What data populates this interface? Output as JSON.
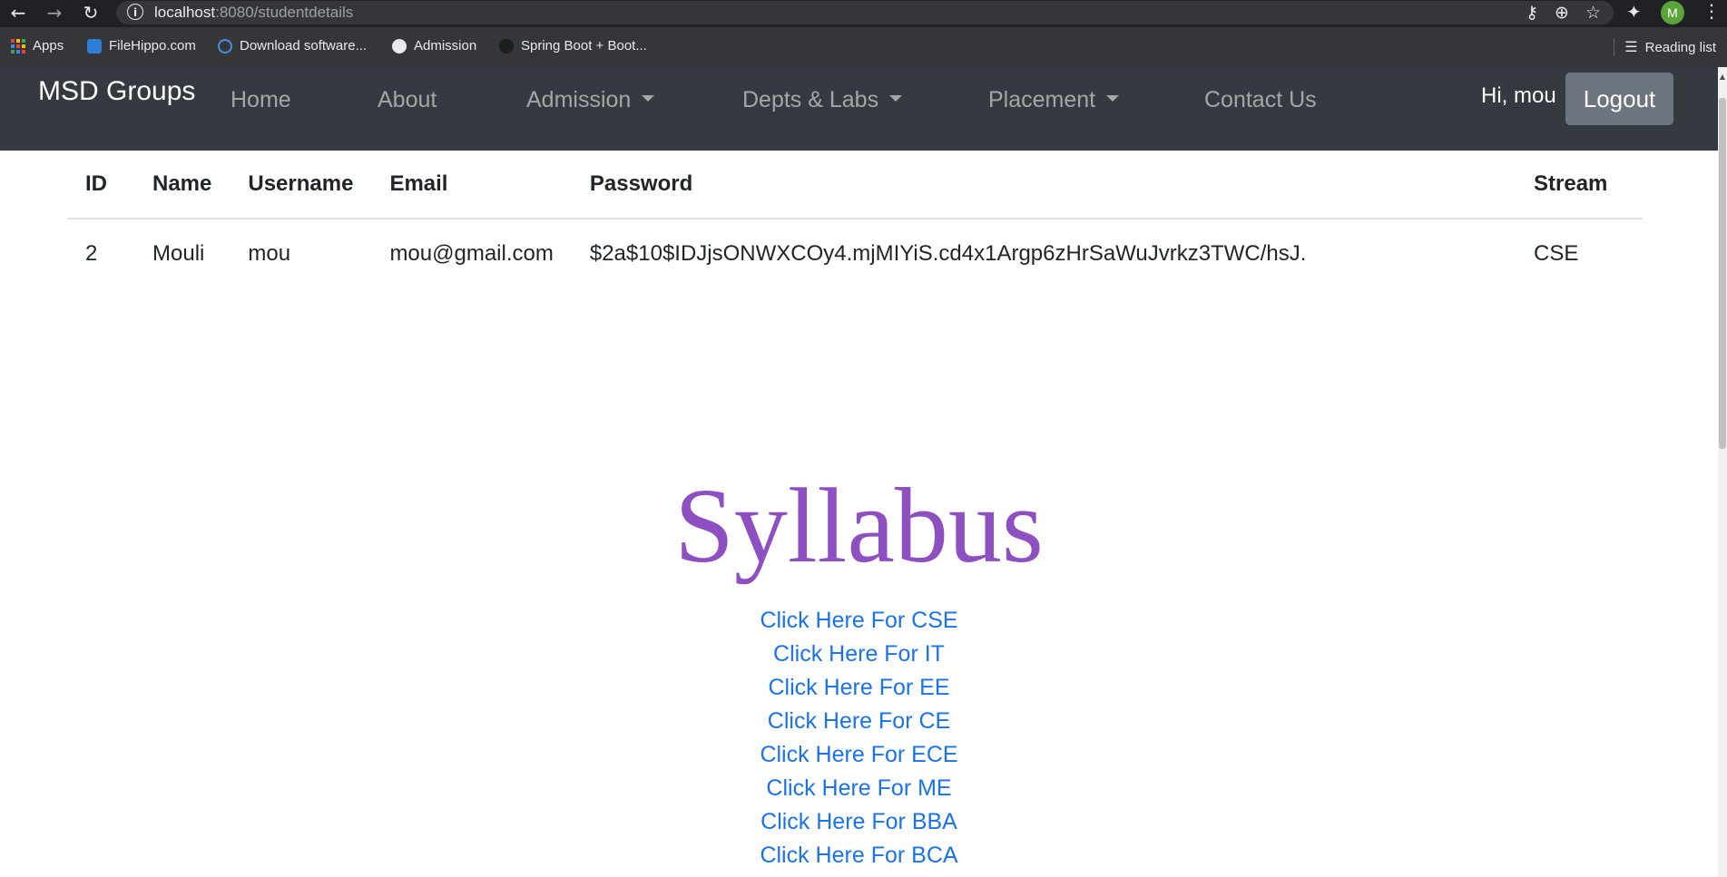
{
  "browser": {
    "url_host": "localhost",
    "url_rest": ":8080/studentdetails",
    "avatar_letter": "M",
    "bookmarks": [
      {
        "label": "Apps"
      },
      {
        "label": "FileHippo.com"
      },
      {
        "label": "Download software..."
      },
      {
        "label": "Admission"
      },
      {
        "label": "Spring Boot + Boot..."
      }
    ],
    "reading_list": "Reading list"
  },
  "navbar": {
    "brand": "MSD Groups",
    "links": [
      {
        "label": "Home"
      },
      {
        "label": "About"
      },
      {
        "label": "Admission"
      },
      {
        "label": "Depts & Labs"
      },
      {
        "label": "Placement"
      },
      {
        "label": "Contact Us"
      }
    ],
    "greeting": "Hi, mou",
    "logout_label": "Logout"
  },
  "table": {
    "headers": [
      "ID",
      "Name",
      "Username",
      "Email",
      "Password",
      "Stream"
    ],
    "rows": [
      [
        "2",
        "Mouli",
        "mou",
        "mou@gmail.com",
        "$2a$10$IDJjsONWXCOy4.mjMIYiS.cd4x1Argp6zHrSaWuJvrkz3TWC/hsJ.",
        "CSE"
      ]
    ]
  },
  "syllabus": {
    "title": "Syllabus",
    "links": [
      "Click Here For CSE",
      "Click Here For IT",
      "Click Here For EE",
      "Click Here For CE",
      "Click Here For ECE",
      "Click Here For ME",
      "Click Here For BBA",
      "Click Here For BCA"
    ]
  },
  "colors": {
    "navbar_bg": "#343a40",
    "syllabus_title": "#8e4fc1",
    "link": "#1a73e8",
    "logout_bg": "#6c757d"
  }
}
